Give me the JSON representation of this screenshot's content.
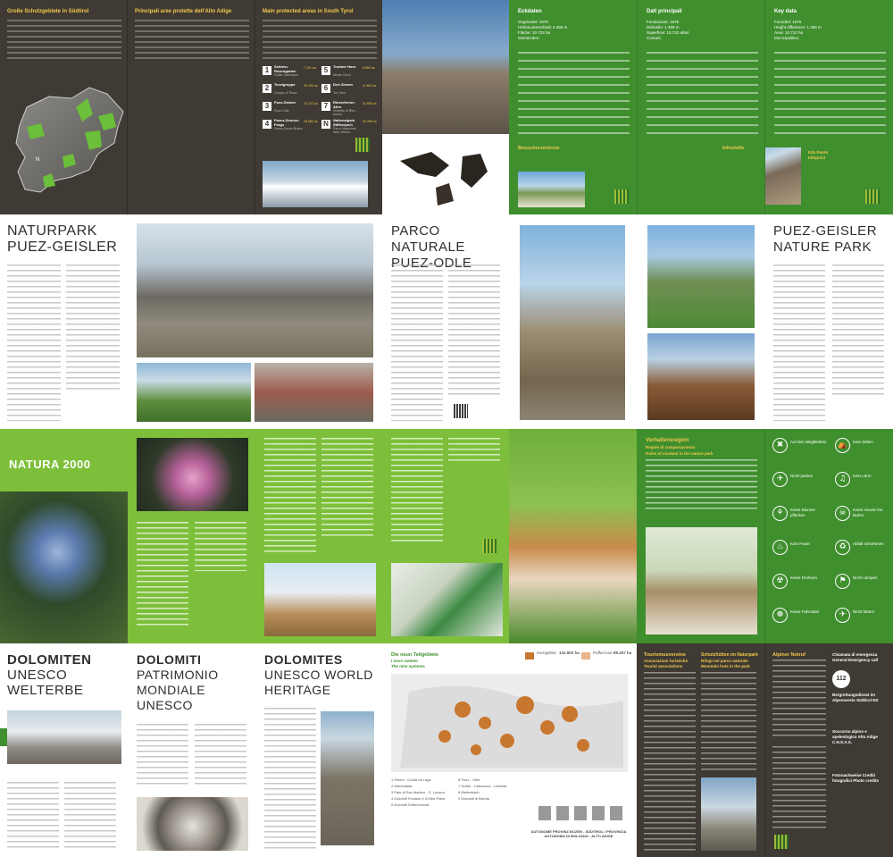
{
  "row1": {
    "panel1": {
      "title": "Große Schutzgebiete in Südtirol",
      "map_label": "N"
    },
    "panel2": {
      "title": "Principali aree protette dell'Alto Adige"
    },
    "panel3": {
      "title": "Main protected areas in South Tyrol",
      "list": [
        {
          "n": "1",
          "name": "Schlern-Rosengarten",
          "sub": "Sciliar-Catinaccio",
          "area": "7.291 ha"
        },
        {
          "n": "2",
          "name": "Texelgruppe",
          "sub": "Gruppo di Tessa",
          "area": "33.430 ha"
        },
        {
          "n": "3",
          "name": "Puez-Geisler",
          "sub": "Puez-Odle",
          "area": "10.722 ha"
        },
        {
          "n": "4",
          "name": "Fanes-Sennes-Prags",
          "sub": "Fanes-Senes-Braies",
          "area": "25.680 ha"
        },
        {
          "n": "5",
          "name": "Trudner Horn",
          "sub": "Monte Corno",
          "area": "6.866 ha"
        },
        {
          "n": "6",
          "name": "Drei Zinnen",
          "sub": "Tre Cime",
          "area": "11.891 ha"
        },
        {
          "n": "7",
          "name": "Rieserferner-Ahrn",
          "sub": "Vedrette di Ries-Aurina",
          "area": "31.505 ha"
        },
        {
          "n": "N",
          "name": "Nationalpark Stilfserjoch",
          "sub": "Parco Nazionale dello Stelvio",
          "area": "53.495 ha"
        }
      ]
    },
    "panel5": {
      "title": "Eckdaten",
      "lines": [
        "Gegründet: 1978",
        "Höhenunterschied: 2.499 m",
        "Fläche: 10.722 ha",
        "Gemeinden:"
      ]
    },
    "panel6": {
      "title": "Dati principali",
      "lines": [
        "Fondazione: 1978",
        "Dislivello: 1.499 m",
        "Superficie: 10.722 ettari",
        "Comuni:"
      ]
    },
    "panel7": {
      "title": "Key data",
      "lines": [
        "Founded: 1978",
        "Height difference: 1.499 m",
        "Area: 10.722 ha",
        "Municipalities:"
      ]
    },
    "visitor1": {
      "title": "Besucherzentrum",
      "sub": "Centro visite",
      "sub2": "Visitor center"
    },
    "visitor2": {
      "title": "Infostelle",
      "sub": "Info Punto",
      "sub2": "Infopoint"
    }
  },
  "row2": {
    "naturpark": {
      "line1": "NATURPARK",
      "line2": "PUEZ-GEISLER"
    },
    "parco": {
      "line1": "PARCO NATURALE",
      "line2": "PUEZ-ODLE"
    },
    "nature_park": {
      "line1": "PUEZ-GEISLER",
      "line2": "NATURE PARK"
    }
  },
  "row3": {
    "natura": {
      "title": "NATURA 2000"
    },
    "rules": {
      "title": "Verhaltensregeln",
      "sub": "Regole di comportamento",
      "sub2": "Rules of conduct in the nature park",
      "items": [
        {
          "icon": "✖",
          "label": "Auf den Wegbleiben"
        },
        {
          "icon": "⛺",
          "label": "Kein Zelten"
        },
        {
          "icon": "✈",
          "label": "Nicht parken"
        },
        {
          "icon": "♫",
          "label": "Kein Lärm"
        },
        {
          "icon": "⚘",
          "label": "Keine Blumen pflücken"
        },
        {
          "icon": "☠",
          "label": "Keine Hunde frei laufen"
        },
        {
          "icon": "♨",
          "label": "Kein Feuer"
        },
        {
          "icon": "♻",
          "label": "Abfall mitnehmen"
        },
        {
          "icon": "☢",
          "label": "Keine Drohnen"
        },
        {
          "icon": "⚑",
          "label": "Nicht campen"
        },
        {
          "icon": "☸",
          "label": "Keine Fahrräder"
        },
        {
          "icon": "✈",
          "label": "Nicht füttern"
        }
      ]
    }
  },
  "row4": {
    "dolomiten": {
      "line1": "DOLOMITEN",
      "line2": "UNESCO",
      "line3": "WELTERBE"
    },
    "dolomiti": {
      "line1": "DOLOMITI",
      "line2": "PATRIMONIO",
      "line3": "MONDIALE",
      "line4": "UNESCO"
    },
    "dolomites": {
      "line1": "DOLOMITES",
      "line2": "UNESCO WORLD",
      "line3": "HERITAGE"
    },
    "neun": {
      "title": "Die neun Teilgebiete",
      "sub": "I nove sistemi",
      "sub2": "The nine systems"
    },
    "legend": {
      "core_label": "Kerngebiet",
      "core_it": "Aree core",
      "core_en": "Core areas",
      "core_value": "141.903 ha",
      "buffer_label": "Pufferzone",
      "buffer_it": "Aree tampone",
      "buffer_en": "Buffer zones",
      "buffer_value": "89.267 ha"
    },
    "systems": [
      "1 Pelmo - Croda da Lago",
      "2 Marmolada",
      "3 Pale di San Martino - S. Lucano",
      "4 Dolomiti Friulane e d'Oltre Piave",
      "5 Dolomiti Settentrionali",
      "6 Puez - Odle",
      "7 Sciliar - Catinaccio - Latemar",
      "8 Bletterbach",
      "9 Dolomiti di Brenta"
    ],
    "footer": "AUTONOME PROVINZ BOZEN - SÜDTIROL / PROVINCIA AUTONOMA DI BOLZANO - ALTO ADIGE",
    "assoc": {
      "title": "Tourismusvereine",
      "sub": "Associazioni turistiche",
      "sub2": "Tourist associations"
    },
    "huts": {
      "title": "Schutzhütten im Naturpark",
      "sub": "Rifugi nel parco naturale",
      "sub2": "Mountain huts in the park"
    },
    "alpine": {
      "title": "Alpiner Notruf",
      "sub": "Chiamata di emergenza",
      "sub2": "General Emergency call",
      "number": "112"
    },
    "bergrettung": "Bergrettungsdienst im Alpenverein Südtirol ED",
    "soccorso": "Soccorso alpino e speleologico Alto Adige C.N.S.A.S.",
    "photo": "Fotonachweise Crediti fotografici Photo credits"
  }
}
